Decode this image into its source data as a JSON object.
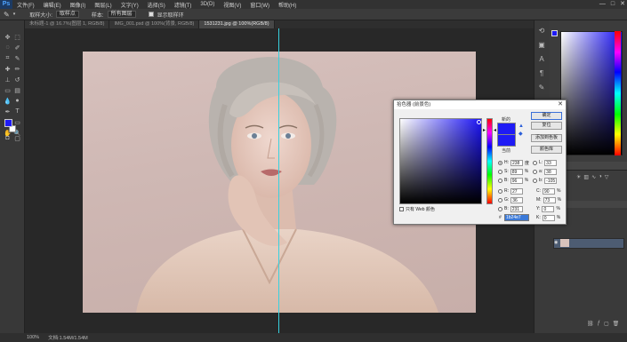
{
  "app": {
    "logo": "Ps"
  },
  "menu": {
    "items": [
      "文件(F)",
      "编辑(E)",
      "图像(I)",
      "图层(L)",
      "文字(Y)",
      "选择(S)",
      "滤镜(T)",
      "3D(D)",
      "视图(V)",
      "窗口(W)",
      "帮助(H)"
    ],
    "window_buttons": [
      "—",
      "□",
      "✕"
    ]
  },
  "options": {
    "sample_label": "取样大小:",
    "sample_value": "取样点",
    "sample_from_label": "样本:",
    "sample_from_value": "所有图层",
    "show_ring_label": "显示取样环"
  },
  "tabs": [
    "未标题-1 @ 16.7%(图层 1, RGB/8)",
    "IMG_001.psd @ 100%(背景, RGB/8)",
    "1531231.jpg @ 100%(RGB/8)"
  ],
  "status": {
    "zoom": "100%",
    "doc": "文档:1.54M/1.54M"
  },
  "colors": {
    "selected": "#1f1bf5",
    "guide": "#38d1e0"
  },
  "dialog": {
    "title": "拾色器 (前景色)",
    "new_label": "新的",
    "current_label": "当前",
    "buttons": {
      "ok": "确定",
      "reset": "复位",
      "add_swatch": "添加到色板",
      "libraries": "颜色库"
    },
    "fields": {
      "H": {
        "label": "H:",
        "value": "238",
        "unit": "度"
      },
      "S": {
        "label": "S:",
        "value": "89",
        "unit": "%"
      },
      "B": {
        "label": "B:",
        "value": "96",
        "unit": "%"
      },
      "R": {
        "label": "R:",
        "value": "27"
      },
      "G": {
        "label": "G:",
        "value": "36"
      },
      "Bl": {
        "label": "B:",
        "value": "231"
      },
      "L": {
        "label": "L:",
        "value": "33"
      },
      "a": {
        "label": "a:",
        "value": "38"
      },
      "b": {
        "label": "b:",
        "value": "-105"
      },
      "C": {
        "label": "C:",
        "value": "90",
        "unit": "%"
      },
      "M": {
        "label": "M:",
        "value": "73",
        "unit": "%"
      },
      "Y": {
        "label": "Y:",
        "value": "0",
        "unit": "%"
      },
      "K": {
        "label": "K:",
        "value": "0",
        "unit": "%"
      }
    },
    "hex_label": "#",
    "hex_value": "1b24e7",
    "web_only_label": "只有 Web 颜色"
  }
}
